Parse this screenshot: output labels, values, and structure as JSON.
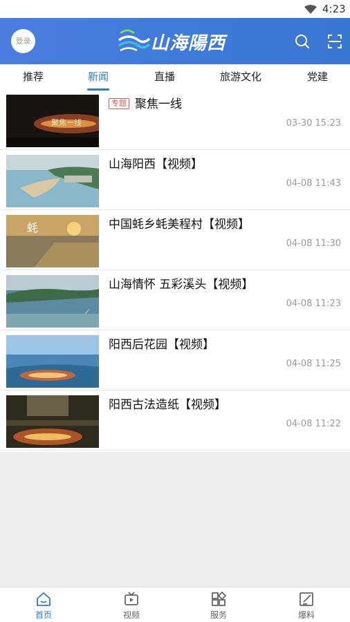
{
  "status_bar": {
    "time": "4:23",
    "wifi_icon": "wifi-icon"
  },
  "header": {
    "login_label": "登录",
    "logo_text": "山海陽西",
    "search_icon": "search-icon",
    "scan_icon": "scan-icon",
    "brand_color": "#3f7ad9"
  },
  "tabs": [
    {
      "label": "推荐",
      "active": false
    },
    {
      "label": "新闻",
      "active": true
    },
    {
      "label": "直播",
      "active": false
    },
    {
      "label": "旅游文化",
      "active": false
    },
    {
      "label": "党建",
      "active": false
    }
  ],
  "news": [
    {
      "tag": "专题",
      "title": "聚焦一线",
      "time": "03-30 15:23",
      "thumb_caption": "聚焦一线"
    },
    {
      "title": "山海阳西【视频】",
      "time": "04-08 11:43"
    },
    {
      "title": "中国蚝乡蚝美程村【视频】",
      "time": "04-08 11:30",
      "thumb_caption": "蚝"
    },
    {
      "title": "山海情怀 五彩溪头【视频】",
      "time": "04-08 11:23"
    },
    {
      "title": "阳西后花园【视频】",
      "time": "04-08 11:25"
    },
    {
      "title": "阳西古法造纸【视频】",
      "time": "04-08 11:22"
    }
  ],
  "bottom_nav": [
    {
      "label": "首页",
      "icon": "home-icon",
      "active": true
    },
    {
      "label": "视频",
      "icon": "video-icon",
      "active": false
    },
    {
      "label": "服务",
      "icon": "services-icon",
      "active": false
    },
    {
      "label": "爆料",
      "icon": "report-icon",
      "active": false
    }
  ],
  "colors": {
    "accent": "#2b7ad8",
    "tag": "#e2554b",
    "time": "#9a9a9a"
  }
}
